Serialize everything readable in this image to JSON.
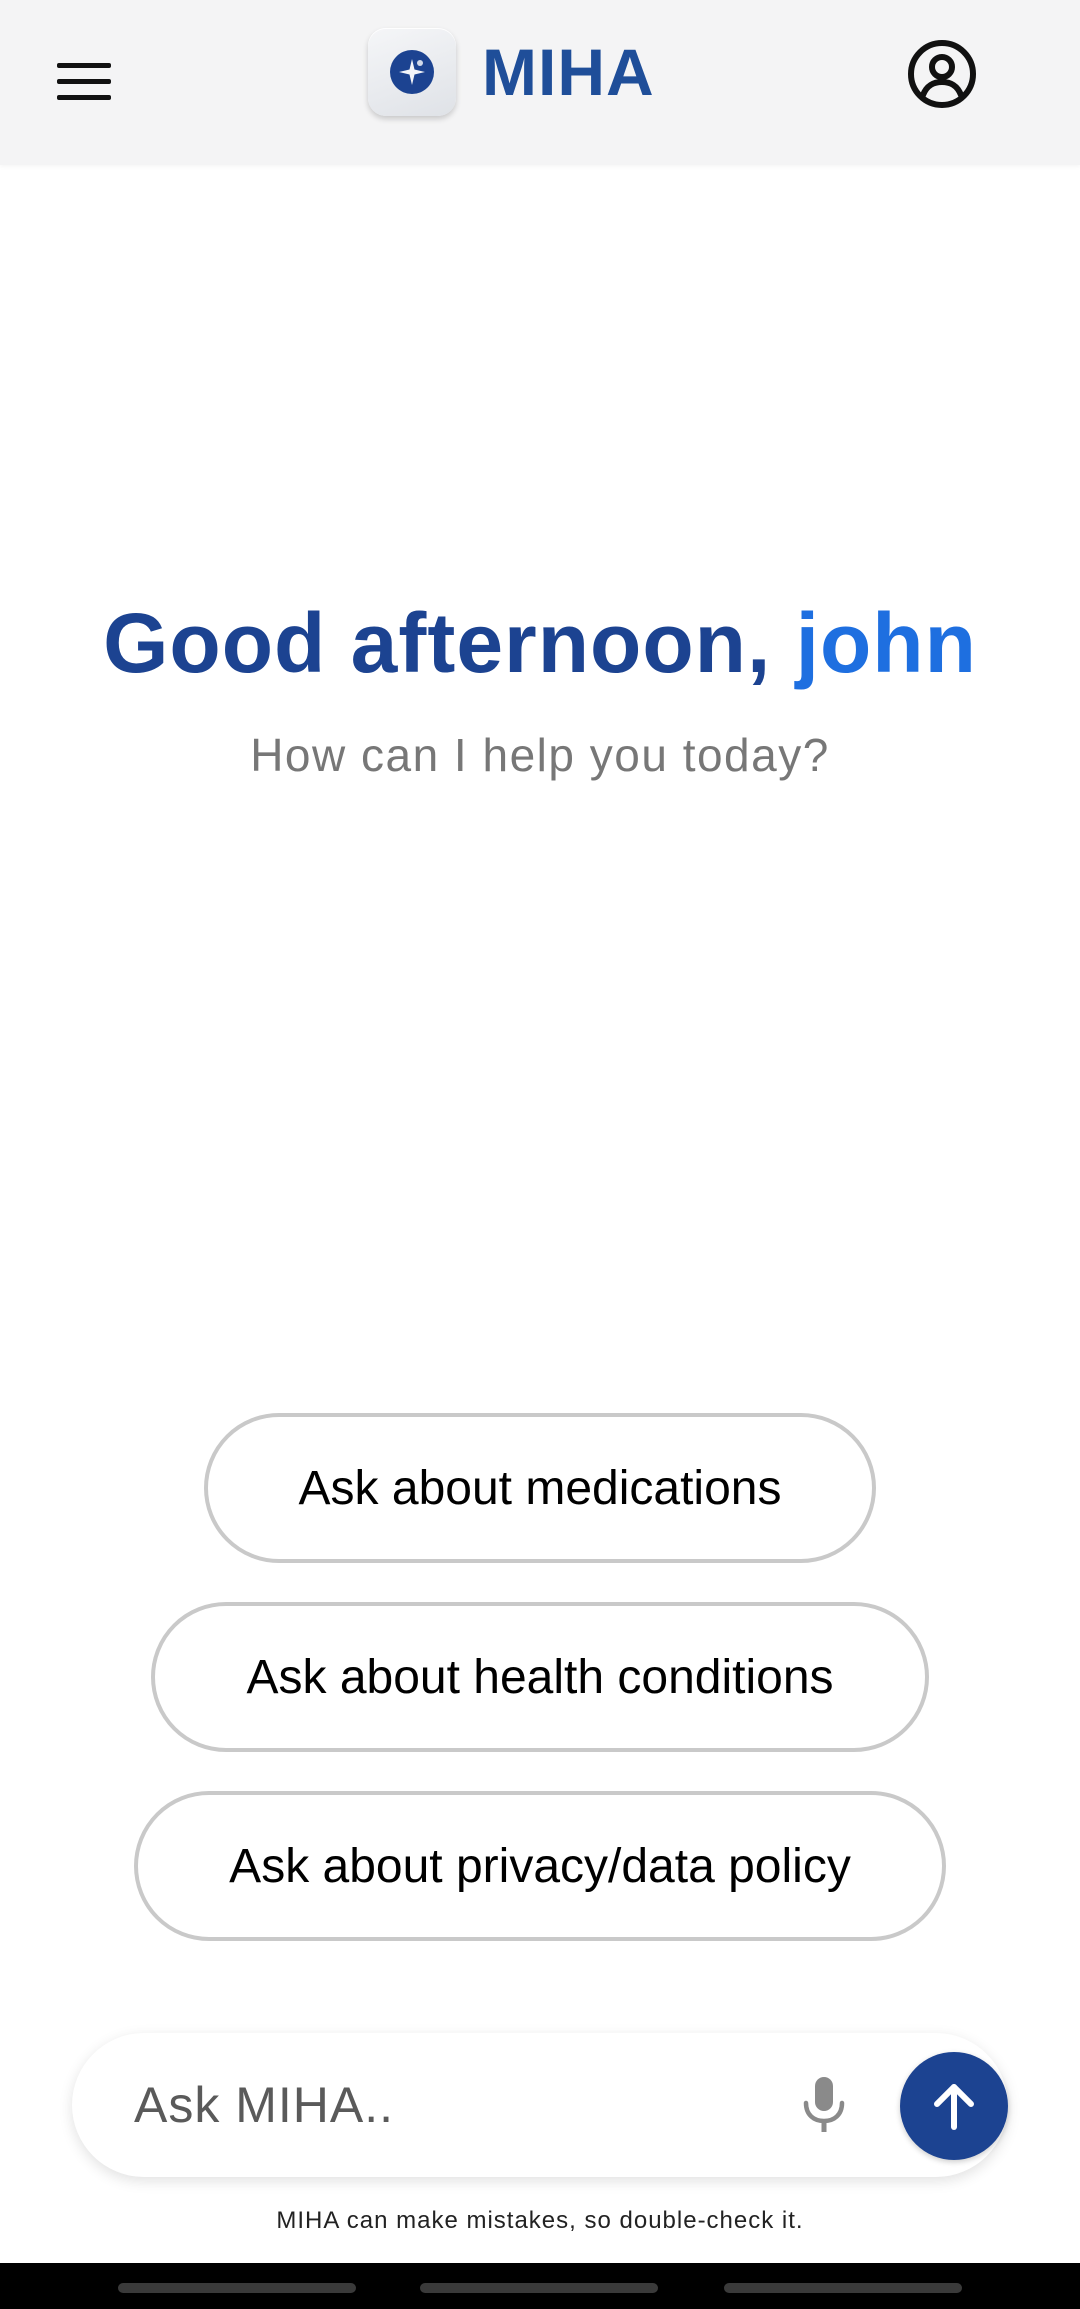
{
  "header": {
    "app_name": "MIHA",
    "menu_icon": "hamburger-menu-icon",
    "profile_icon": "account-circle-icon",
    "logo_icon": "miha-logo-icon"
  },
  "greeting": {
    "prefix": "Good afternoon, ",
    "name": "john",
    "subtitle": "How can I help you today?"
  },
  "suggestions": [
    {
      "label": "Ask about medications"
    },
    {
      "label": "Ask about health conditions"
    },
    {
      "label": "Ask about privacy/data policy"
    }
  ],
  "input": {
    "placeholder": "Ask MIHA..",
    "value": "",
    "mic_icon": "microphone-icon",
    "send_icon": "arrow-up-icon"
  },
  "disclaimer": "MIHA can make mistakes, so double-check it.",
  "colors": {
    "header_bg": "#f4f4f5",
    "primary": "#1c4391",
    "accent": "#1e6fe0",
    "subtitle": "#777777",
    "chip_border": "#c9c9c9"
  }
}
